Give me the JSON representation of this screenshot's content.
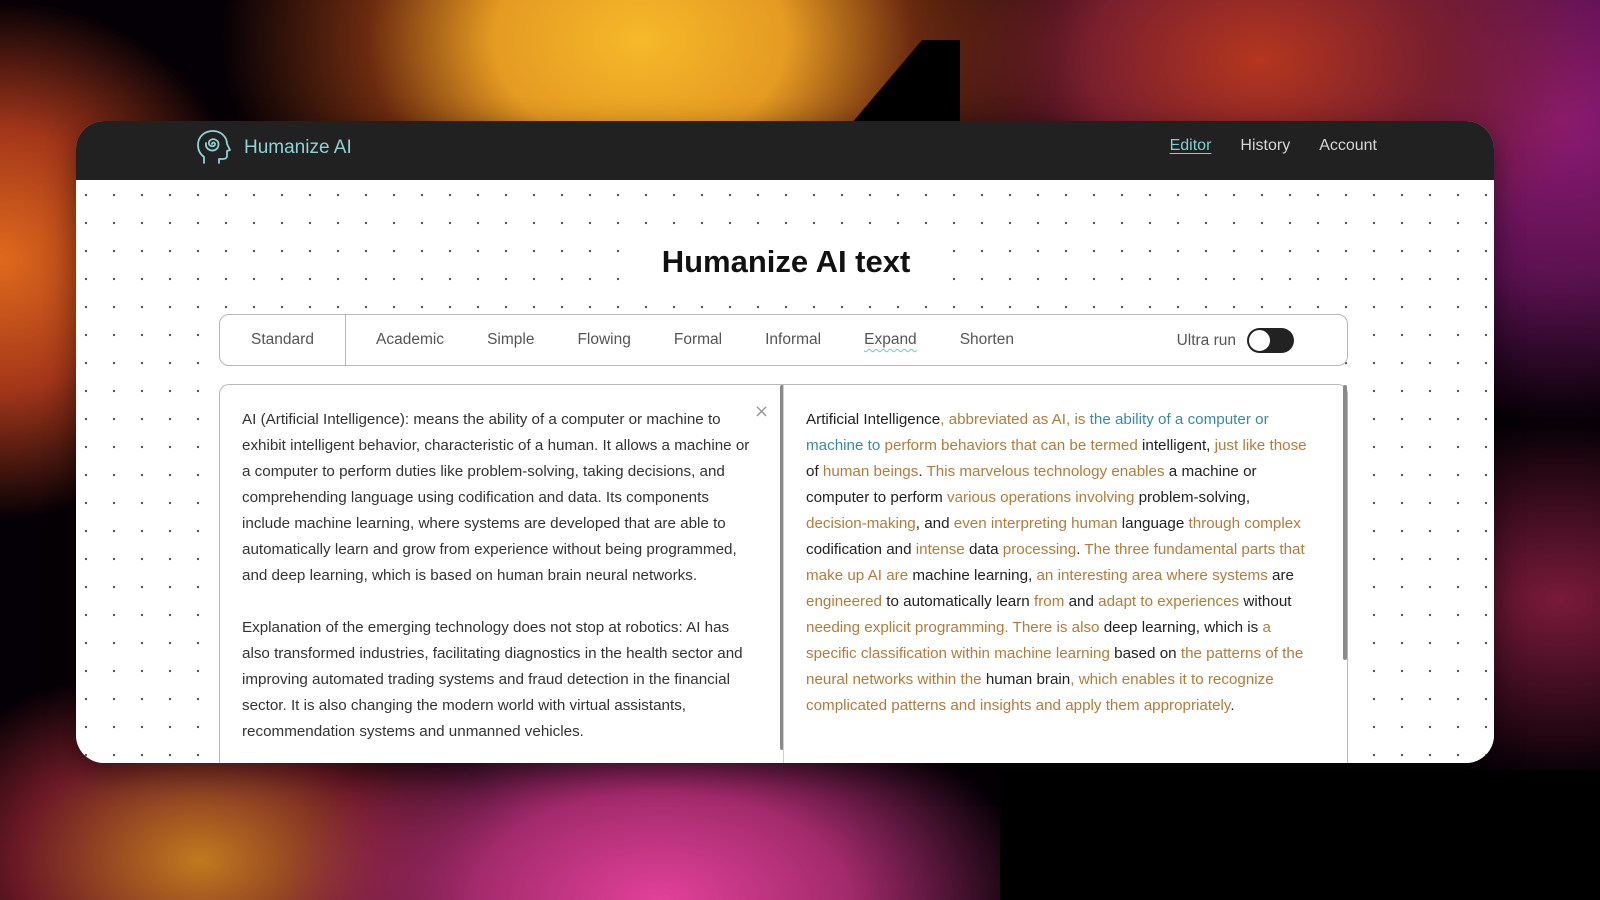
{
  "app": {
    "name": "Humanize AI",
    "logo_icon": "head-spiral-icon"
  },
  "nav": {
    "items": [
      {
        "label": "Editor",
        "active": true
      },
      {
        "label": "History",
        "active": false
      },
      {
        "label": "Account",
        "active": false
      }
    ]
  },
  "page": {
    "title": "Humanize AI text"
  },
  "modes": {
    "items": [
      "Standard",
      "Academic",
      "Simple",
      "Flowing",
      "Formal",
      "Informal",
      "Expand",
      "Shorten"
    ],
    "selected": "Expand",
    "ultra_run": {
      "label": "Ultra run",
      "enabled": true
    }
  },
  "input": {
    "clear_icon": "close-icon",
    "paragraphs": [
      "AI (Artificial Intelligence): means the ability of a computer or machine to exhibit intelligent behavior, characteristic of a human. It allows a machine or a computer to perform duties like problem-solving, taking decisions, and comprehending language using codification and data. Its components include machine learning, where systems are developed that are able to automatically learn and grow from experience without being programmed, and deep learning, which is based on human brain neural networks.",
      "Explanation of the emerging technology does not stop at robotics: AI has also transformed industries, facilitating diagnostics in the health sector and improving automated trading systems and fraud detection in the financial sector. It is also changing the modern world with virtual assistants, recommendation systems and unmanned vehicles."
    ]
  },
  "output": {
    "colors": {
      "unchanged": "#222222",
      "changed": "#b07c3c",
      "synonym": "#3a8aa0"
    },
    "segments": [
      {
        "t": "Artificial Intelligence",
        "k": "unchanged"
      },
      {
        "t": ", abbreviated as AI, is ",
        "k": "changed"
      },
      {
        "t": "the ability of a computer or machine to ",
        "k": "synonym"
      },
      {
        "t": "perform behaviors that can be termed",
        "k": "changed"
      },
      {
        "t": " intelligent, ",
        "k": "unchanged"
      },
      {
        "t": "just like those",
        "k": "changed"
      },
      {
        "t": " of ",
        "k": "unchanged"
      },
      {
        "t": "human beings",
        "k": "changed"
      },
      {
        "t": ". ",
        "k": "unchanged"
      },
      {
        "t": "This marvelous technology enables",
        "k": "changed"
      },
      {
        "t": " a machine or computer to perform ",
        "k": "unchanged"
      },
      {
        "t": "various operations involving",
        "k": "changed"
      },
      {
        "t": " problem-solving, ",
        "k": "unchanged"
      },
      {
        "t": "decision-making",
        "k": "changed"
      },
      {
        "t": ", and ",
        "k": "unchanged"
      },
      {
        "t": "even interpreting human",
        "k": "changed"
      },
      {
        "t": " language ",
        "k": "unchanged"
      },
      {
        "t": "through complex",
        "k": "changed"
      },
      {
        "t": " codification and ",
        "k": "unchanged"
      },
      {
        "t": "intense",
        "k": "changed"
      },
      {
        "t": " data ",
        "k": "unchanged"
      },
      {
        "t": "processing",
        "k": "changed"
      },
      {
        "t": ". ",
        "k": "unchanged"
      },
      {
        "t": "The three fundamental parts that make up AI are",
        "k": "changed"
      },
      {
        "t": " machine learning, ",
        "k": "unchanged"
      },
      {
        "t": "an interesting area where systems",
        "k": "changed"
      },
      {
        "t": " are ",
        "k": "unchanged"
      },
      {
        "t": "engineered",
        "k": "changed"
      },
      {
        "t": " to automatically learn ",
        "k": "unchanged"
      },
      {
        "t": "from",
        "k": "changed"
      },
      {
        "t": " and ",
        "k": "unchanged"
      },
      {
        "t": "adapt to experiences",
        "k": "changed"
      },
      {
        "t": " without ",
        "k": "unchanged"
      },
      {
        "t": "needing explicit programming. There is also",
        "k": "changed"
      },
      {
        "t": " deep learning, which is ",
        "k": "unchanged"
      },
      {
        "t": "a specific classification within machine learning",
        "k": "changed"
      },
      {
        "t": " based on ",
        "k": "unchanged"
      },
      {
        "t": "the patterns of the neural networks within the",
        "k": "changed"
      },
      {
        "t": " human brain",
        "k": "unchanged"
      },
      {
        "t": ", which enables it to recognize complicated patterns and insights and apply them appropriately",
        "k": "changed"
      },
      {
        "t": ".",
        "k": "unchanged"
      }
    ]
  }
}
